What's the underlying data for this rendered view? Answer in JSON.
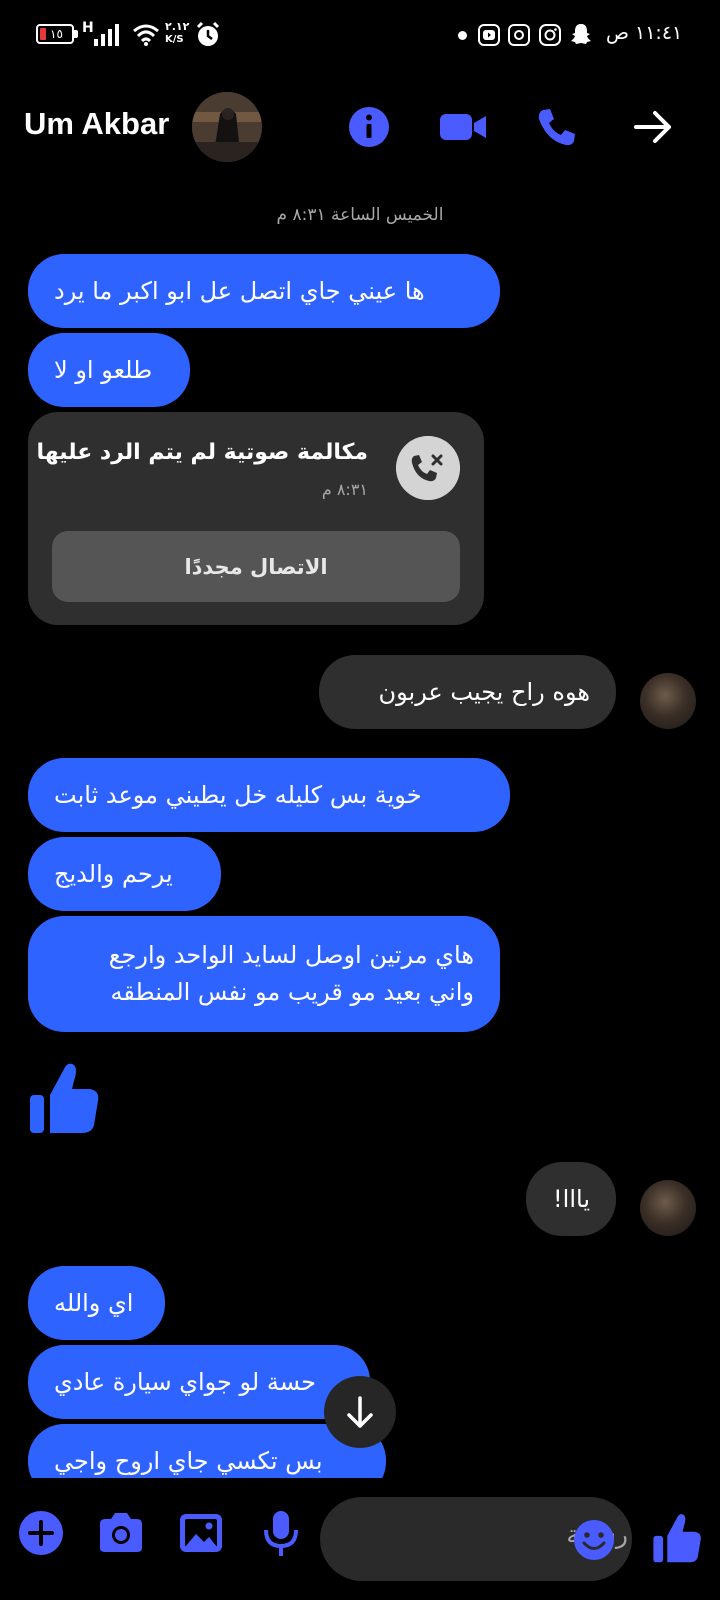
{
  "status_bar": {
    "time": "١١:٤١ ص",
    "battery": "١٥",
    "network": "H",
    "speed_value": "٢.١٢",
    "speed_unit": "K/S",
    "icons": [
      "battery-icon",
      "signal-icon",
      "wifi-icon",
      "alarm-icon",
      "dot-icon",
      "youtube-icon",
      "threads-icon",
      "instagram-icon",
      "snapchat-icon"
    ]
  },
  "header": {
    "contact_name": "Um Akbar",
    "icons": [
      "info-icon",
      "video-call-icon",
      "phone-icon",
      "forward-arrow-icon"
    ]
  },
  "timestamp": "الخميس الساعة ٨:٣١ م",
  "messages": [
    {
      "side": "sent",
      "text": "ها عيني جاي اتصل عل ابو اكبر ما يرد"
    },
    {
      "side": "sent",
      "text": "طلعو او لا"
    },
    {
      "side": "received",
      "text": "هوه راح يجيب عربون"
    },
    {
      "side": "sent",
      "text": "خوية بس كليله خل يطيني موعد ثابت"
    },
    {
      "side": "sent",
      "text": "يرحم والديج"
    },
    {
      "side": "sent",
      "line1": "هاي مرتين اوصل لسايد الواحد وارجع",
      "line2": "واني بعيد مو قريب مو نفس المنطقه"
    },
    {
      "side": "received",
      "text": "يااا!"
    },
    {
      "side": "sent",
      "text": "اي والله"
    },
    {
      "side": "sent",
      "text": "حسة لو جواي سيارة عادي"
    },
    {
      "side": "sent",
      "text": "بس تكسي جاي اروح واجي"
    }
  ],
  "missed_call": {
    "title": "مكالمة صوتية لم يتم الرد عليها",
    "time": "٨:٣١ م",
    "button": "الاتصال مجددًا"
  },
  "composer": {
    "placeholder": "رسالة"
  },
  "colors": {
    "accent": "#2f63ff",
    "icon_accent": "#4a5cff",
    "bubble_gray": "#2f2f2f",
    "background": "#000000"
  }
}
